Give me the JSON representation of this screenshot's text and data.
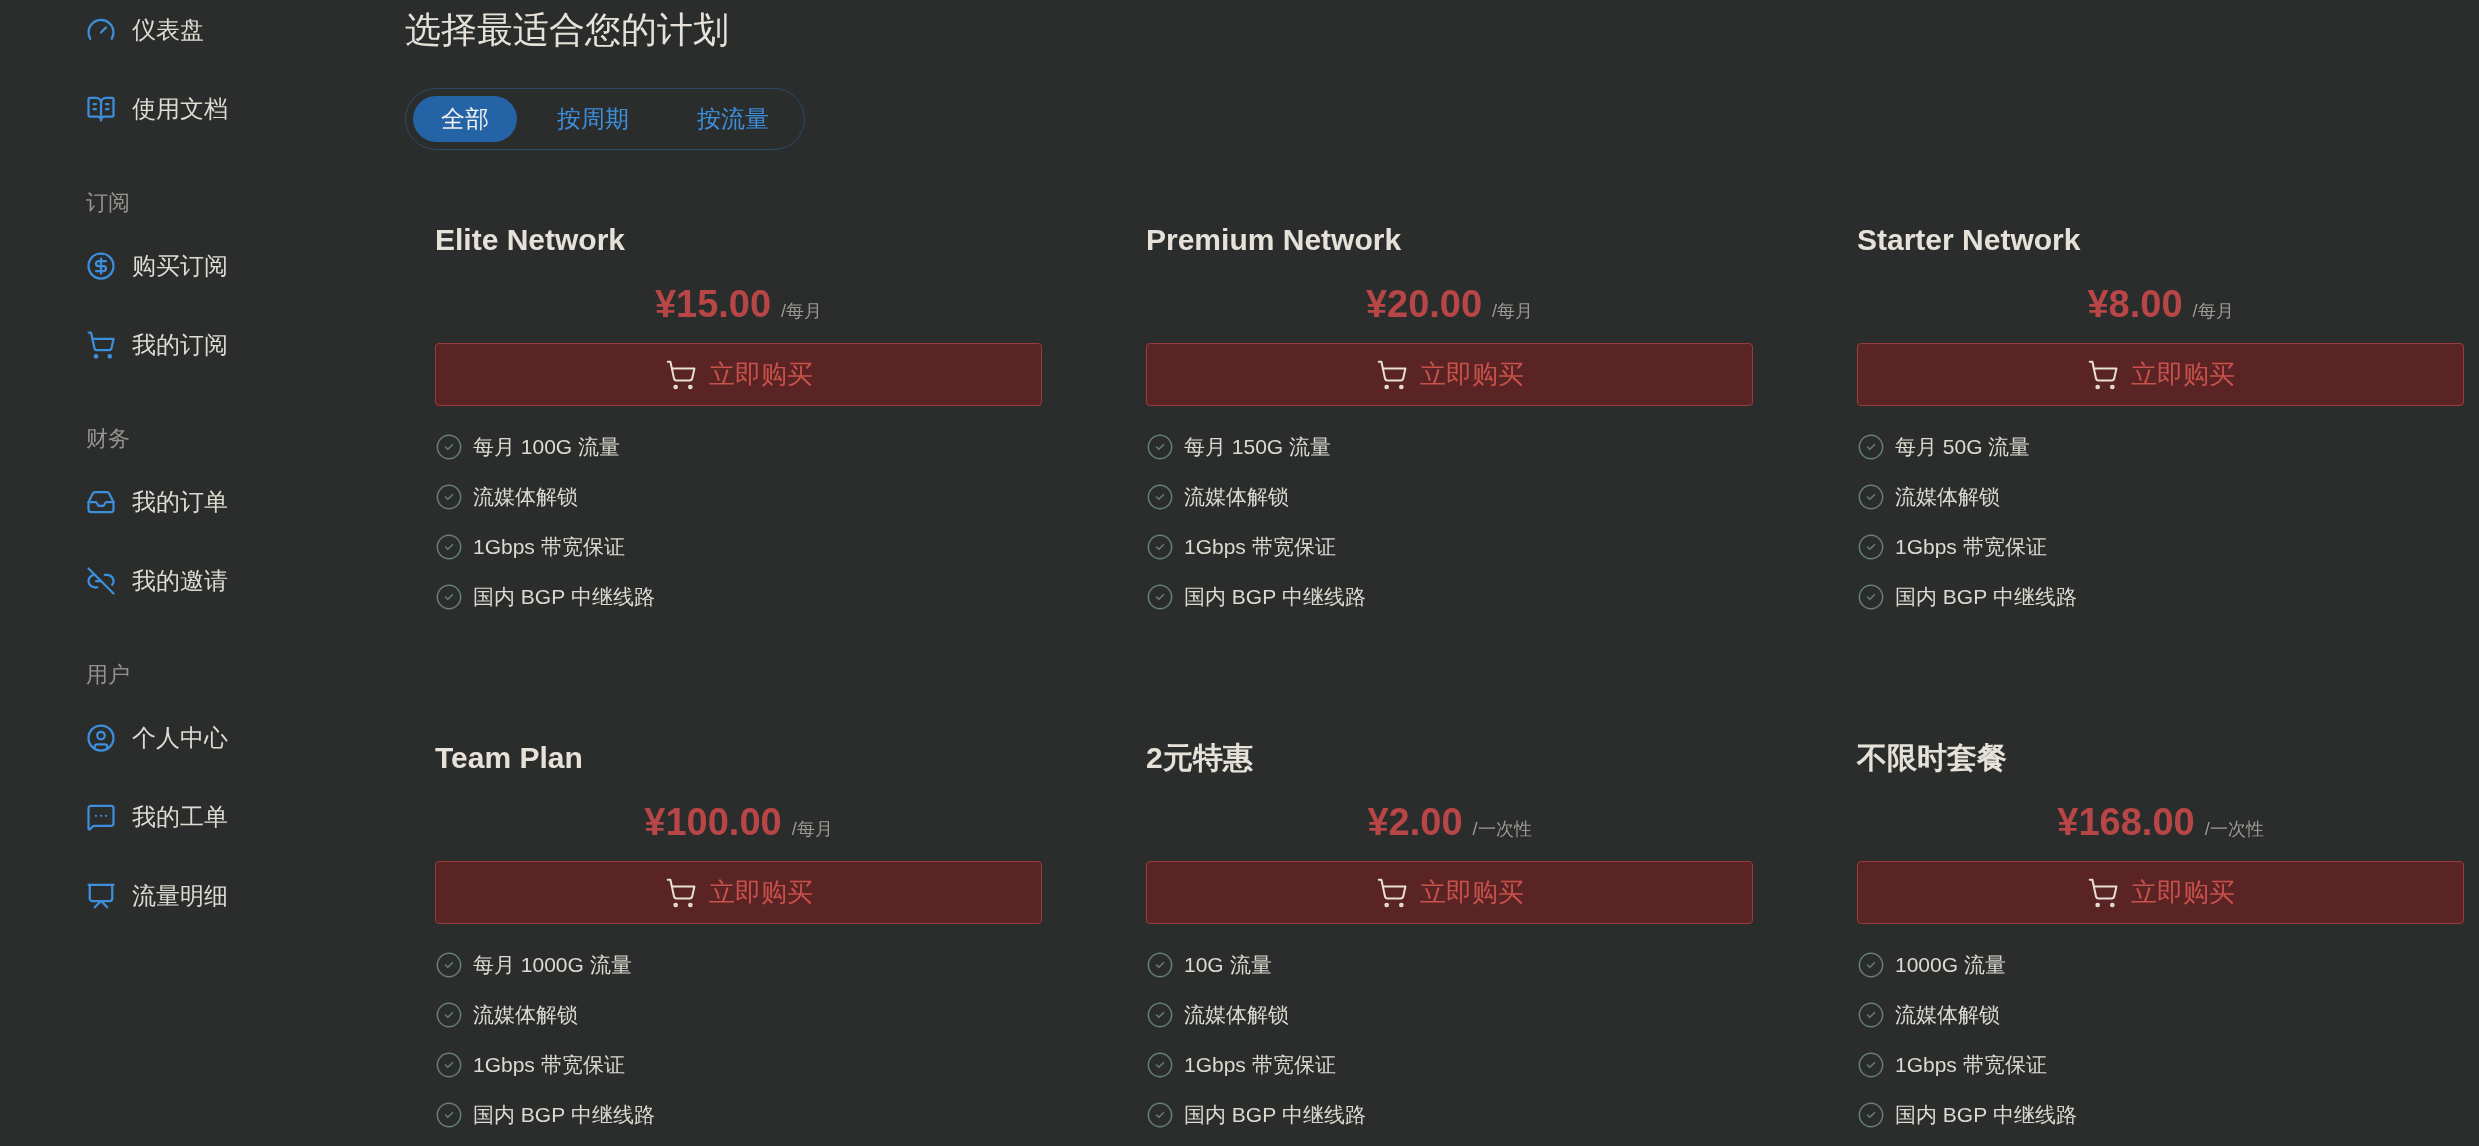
{
  "sidebar": {
    "sections": [
      {
        "items": [
          {
            "label": "仪表盘"
          },
          {
            "label": "使用文档"
          }
        ]
      },
      {
        "title": "订阅",
        "items": [
          {
            "label": "购买订阅"
          },
          {
            "label": "我的订阅"
          }
        ]
      },
      {
        "title": "财务",
        "items": [
          {
            "label": "我的订单"
          },
          {
            "label": "我的邀请"
          }
        ]
      },
      {
        "title": "用户",
        "items": [
          {
            "label": "个人中心"
          },
          {
            "label": "我的工单"
          },
          {
            "label": "流量明细"
          }
        ]
      }
    ]
  },
  "page_title": "选择最适合您的计划",
  "tabs": [
    {
      "label": "全部",
      "selected": true
    },
    {
      "label": "按周期",
      "selected": false
    },
    {
      "label": "按流量",
      "selected": false
    }
  ],
  "plans": [
    {
      "name": "Elite Network",
      "price": "¥15.00",
      "period": "/每月",
      "button": "立即购买",
      "features": [
        "每月 100G 流量",
        "流媒体解锁",
        "1Gbps 带宽保证",
        "国内 BGP 中继线路"
      ]
    },
    {
      "name": "Premium Network",
      "price": "¥20.00",
      "period": "/每月",
      "button": "立即购买",
      "features": [
        "每月 150G 流量",
        "流媒体解锁",
        "1Gbps 带宽保证",
        "国内 BGP 中继线路"
      ]
    },
    {
      "name": "Starter Network",
      "price": "¥8.00",
      "period": "/每月",
      "button": "立即购买",
      "features": [
        "每月 50G 流量",
        "流媒体解锁",
        "1Gbps 带宽保证",
        "国内 BGP 中继线路"
      ]
    },
    {
      "name": "Team Plan",
      "price": "¥100.00",
      "period": "/每月",
      "button": "立即购买",
      "features": [
        "每月 1000G 流量",
        "流媒体解锁",
        "1Gbps 带宽保证",
        "国内 BGP 中继线路"
      ]
    },
    {
      "name": "2元特惠",
      "price": "¥2.00",
      "period": "/一次性",
      "button": "立即购买",
      "features": [
        "10G 流量",
        "流媒体解锁",
        "1Gbps 带宽保证",
        "国内 BGP 中继线路"
      ]
    },
    {
      "name": "不限时套餐",
      "price": "¥168.00",
      "period": "/一次性",
      "button": "立即购买",
      "features": [
        "1000G 流量",
        "流媒体解锁",
        "1Gbps 带宽保证",
        "国内 BGP 中继线路"
      ]
    }
  ]
}
